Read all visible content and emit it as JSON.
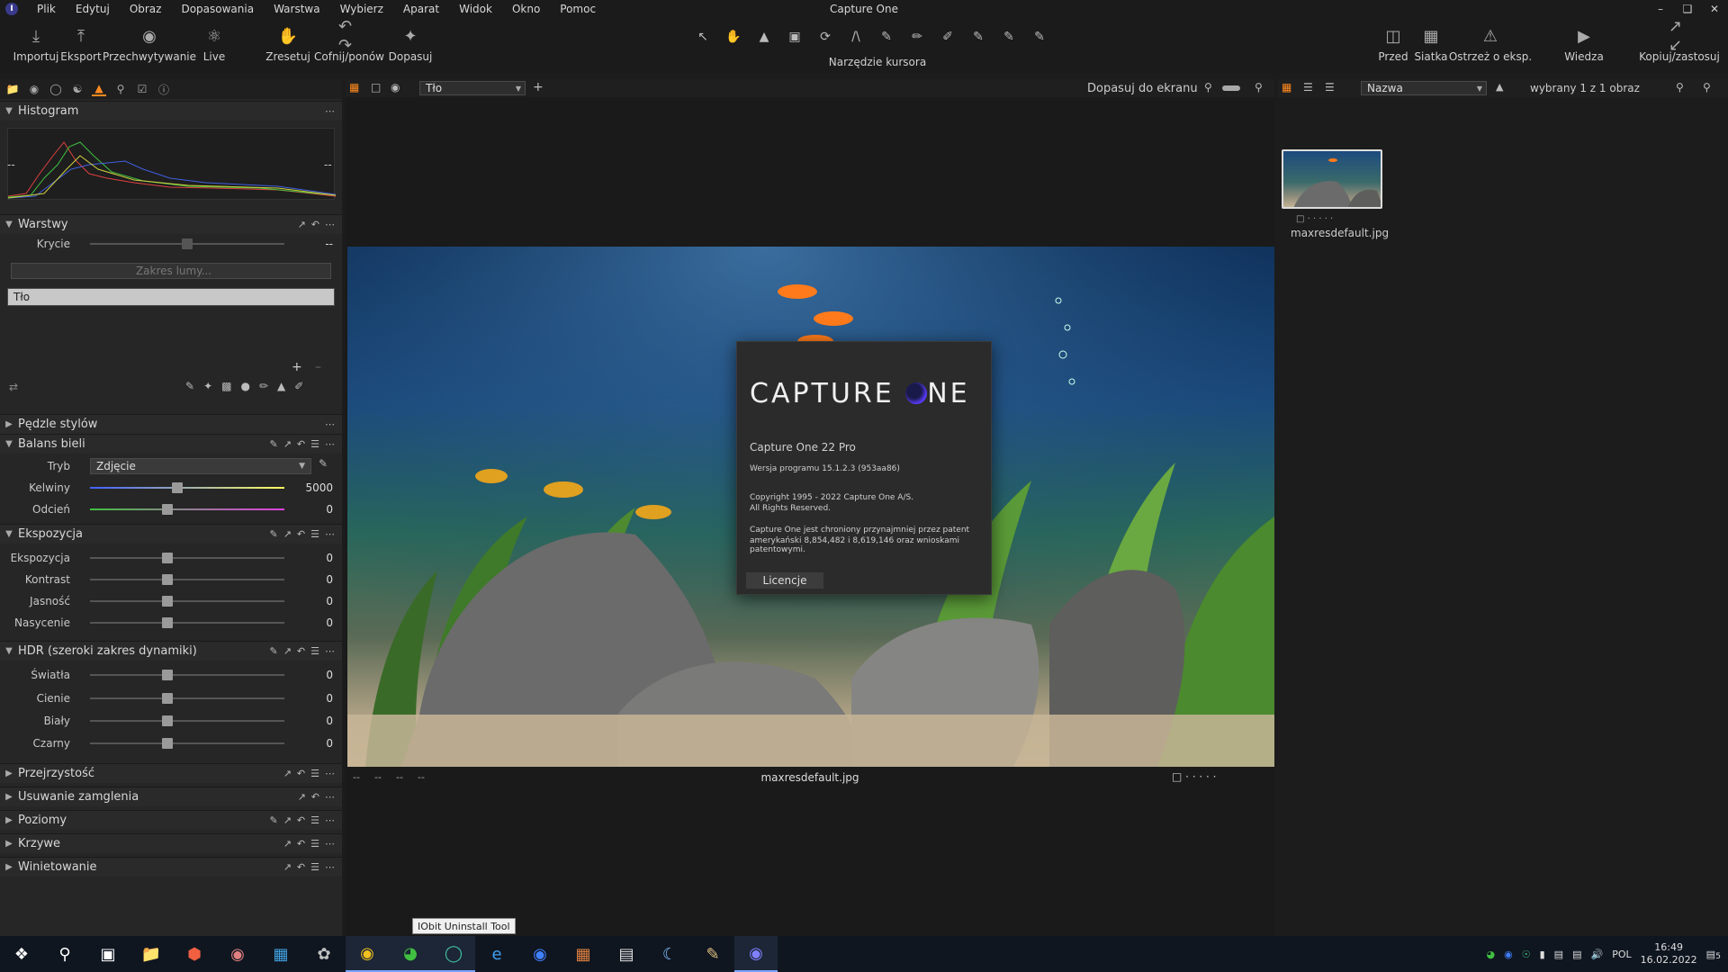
{
  "menubar": {
    "items": [
      "Plik",
      "Edytuj",
      "Obraz",
      "Dopasowania",
      "Warstwa",
      "Wybierz",
      "Aparat",
      "Widok",
      "Okno",
      "Pomoc"
    ],
    "title": "Capture One"
  },
  "toolbar": {
    "left": [
      "Importuj",
      "Eksport",
      "Przechwytywanie",
      "Live",
      "Zresetuj",
      "Cofnij/ponów",
      "Dopasuj"
    ],
    "cursor_tools_label": "Narzędzie kursora",
    "right": [
      "Przed",
      "Siatka",
      "Ostrzeż o eksp.",
      "Wiedza",
      "Kopiuj/zastosuj"
    ]
  },
  "center": {
    "layer_select": "Tło",
    "fit_label": "Dopasuj do ekranu",
    "filename": "maxresdefault.jpg",
    "meta": [
      "--",
      "--",
      "--",
      "--"
    ]
  },
  "right": {
    "sort_select": "Nazwa",
    "selected_count": "wybrany 1 z 1 obraz",
    "thumb_name": "maxresdefault.jpg"
  },
  "left": {
    "histogram": {
      "title": "Histogram",
      "min": "--",
      "max": "--"
    },
    "layers": {
      "title": "Warstwy",
      "opacity_label": "Krycie",
      "opacity_val": "--",
      "range_btn": "Zakres lumy...",
      "layer_name": "Tło"
    },
    "brushes": {
      "title": "Pędzle stylów"
    },
    "wb": {
      "title": "Balans bieli",
      "mode_label": "Tryb",
      "mode_val": "Zdjęcie",
      "kelvin_label": "Kelwiny",
      "kelvin_val": "5000",
      "tint_label": "Odcień",
      "tint_val": "0"
    },
    "exposure": {
      "title": "Ekspozycja",
      "rows": [
        {
          "label": "Ekspozycja",
          "val": "0"
        },
        {
          "label": "Kontrast",
          "val": "0"
        },
        {
          "label": "Jasność",
          "val": "0"
        },
        {
          "label": "Nasycenie",
          "val": "0"
        }
      ]
    },
    "hdr": {
      "title": "HDR (szeroki zakres dynamiki)",
      "rows": [
        {
          "label": "Światła",
          "val": "0"
        },
        {
          "label": "Cienie",
          "val": "0"
        },
        {
          "label": "Biały",
          "val": "0"
        },
        {
          "label": "Czarny",
          "val": "0"
        }
      ]
    },
    "collapsed": [
      "Przejrzystość",
      "Usuwanie zamglenia",
      "Poziomy",
      "Krzywe",
      "Winietowanie"
    ]
  },
  "dialog": {
    "logo_a": "CAPTURE ",
    "logo_b": "NE",
    "product": "Capture One 22 Pro",
    "version": "Wersja programu 15.1.2.3 (953aa86)",
    "copyright1": "Copyright 1995 - 2022 Capture One A/S.",
    "copyright2": "All Rights Reserved.",
    "patent1": "Capture One jest chroniony przynajmniej przez patent",
    "patent2": "amerykański 8,854,482 i 8,619,146 oraz wnioskami patentowymi.",
    "license_btn": "Licencje"
  },
  "taskbar": {
    "tooltip": "IObit Uninstall Tool",
    "lang": "POL",
    "time": "16:49",
    "date": "16.02.2022",
    "notifications": "5"
  }
}
